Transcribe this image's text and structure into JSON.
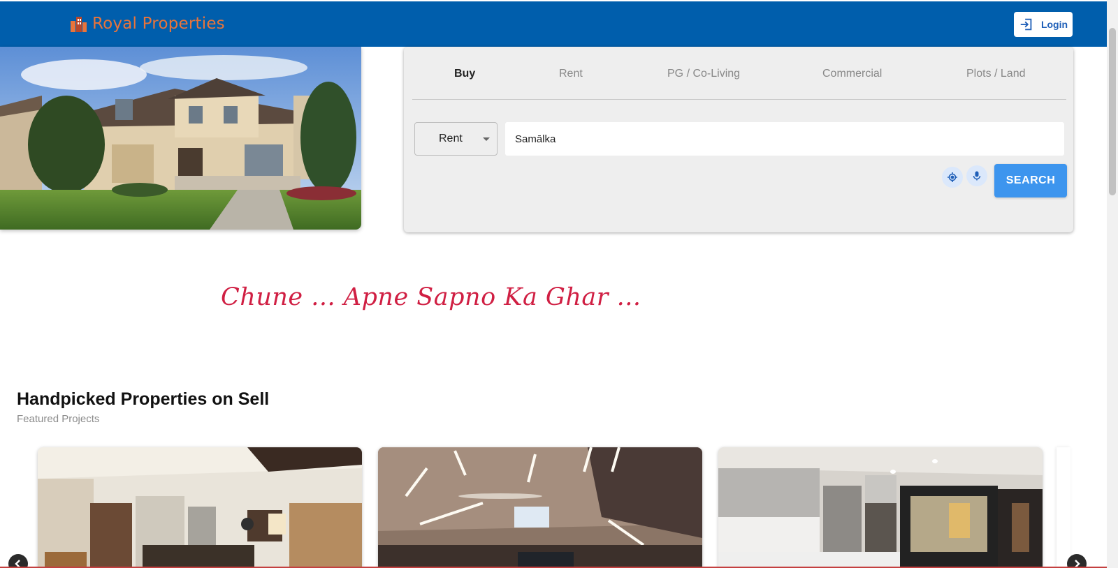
{
  "header": {
    "brand_name": "Royal Properties",
    "brand_logo_icon": "building-logo-icon",
    "login_label": "Login",
    "login_icon": "login-arrow-icon",
    "background_color": "#005eac",
    "brand_color": "#e8743b"
  },
  "hero": {
    "image": "house-photo"
  },
  "search": {
    "tabs": [
      {
        "label": "Buy",
        "active": true
      },
      {
        "label": "Rent",
        "active": false
      },
      {
        "label": "PG / Co-Living",
        "active": false
      },
      {
        "label": "Commercial",
        "active": false
      },
      {
        "label": "Plots / Land",
        "active": false
      }
    ],
    "type_select_value": "Rent",
    "location_value": "Samālka",
    "location_icon": "crosshair-location-icon",
    "mic_icon": "microphone-icon",
    "search_button_label": "SEARCH",
    "button_color": "#3d95ee"
  },
  "tagline": "Chune ... Apne Sapno Ka Ghar ...",
  "featured": {
    "title": "Handpicked Properties on Sell",
    "subtitle": "Featured Projects",
    "cards": [
      {
        "image": "interior-living-room-photo"
      },
      {
        "image": "interior-ceiling-lights-photo"
      },
      {
        "image": "interior-kitchen-photo"
      }
    ],
    "prev_icon": "chevron-left-icon",
    "next_icon": "chevron-right-icon"
  }
}
